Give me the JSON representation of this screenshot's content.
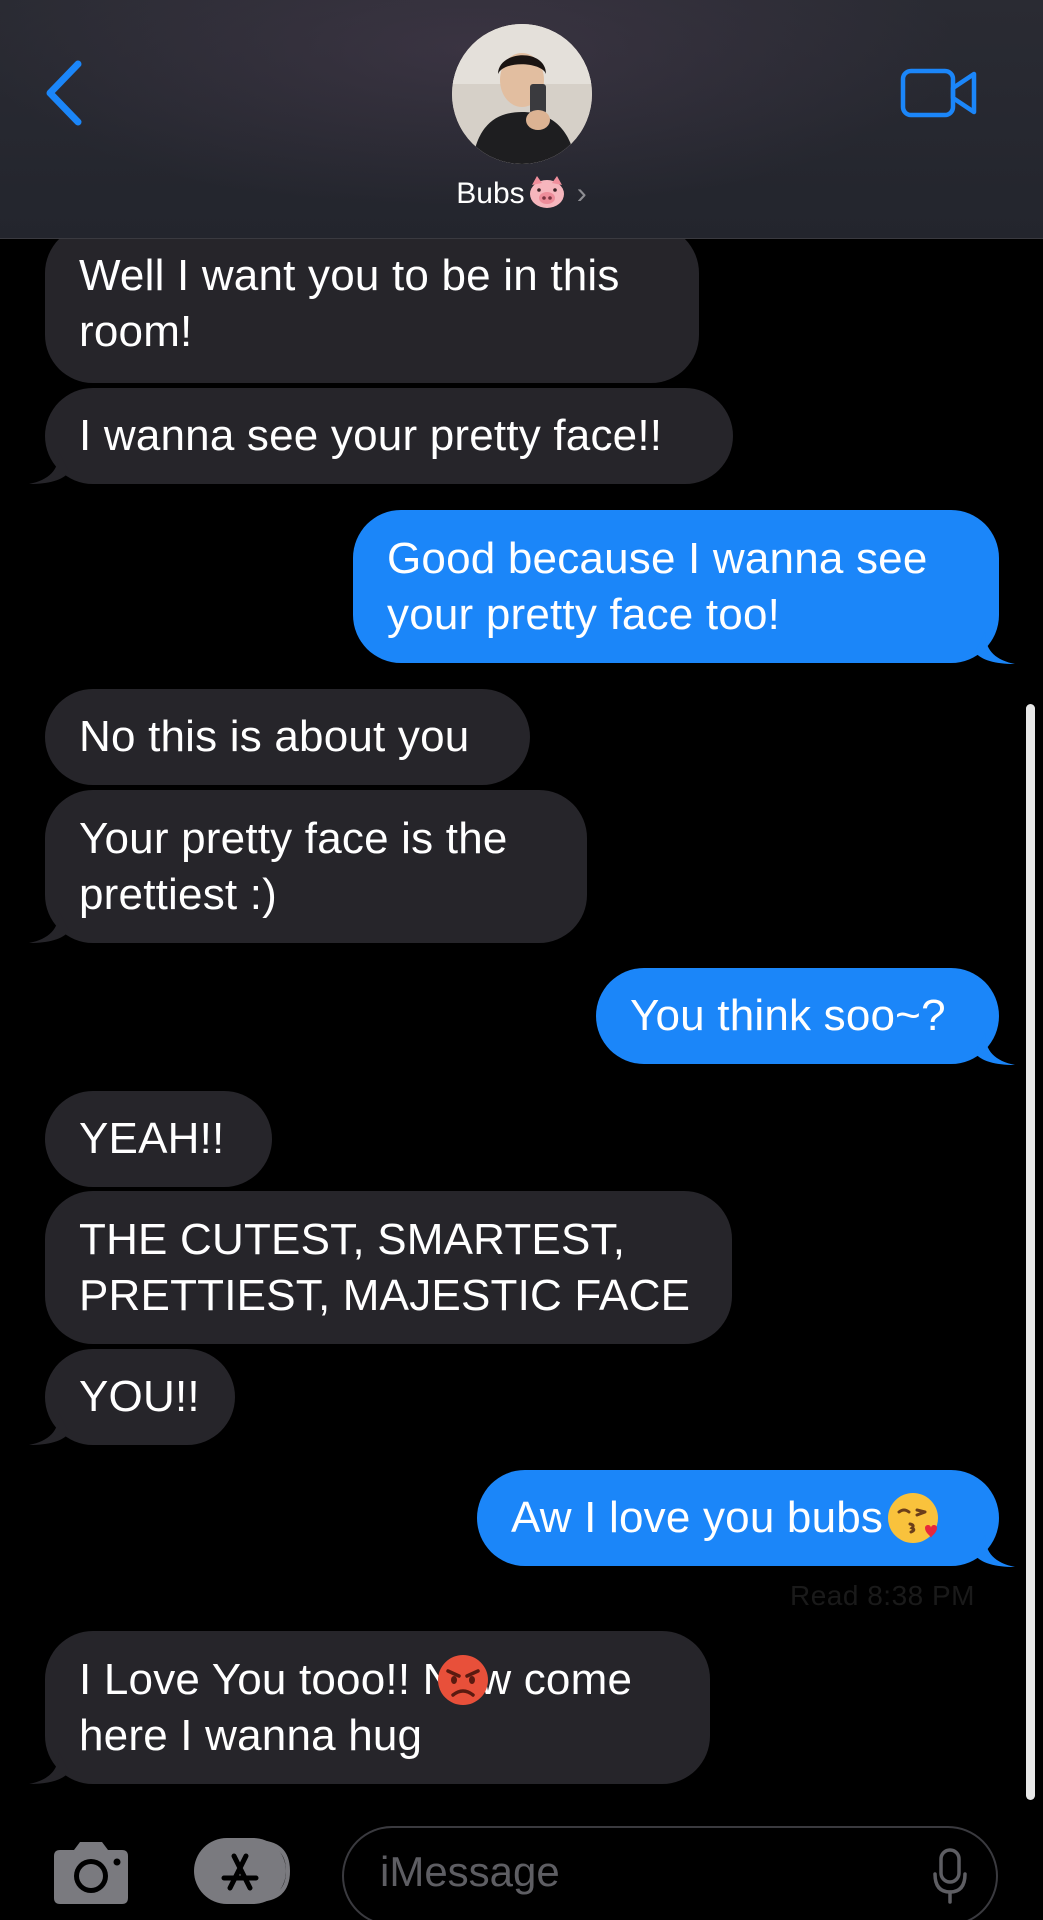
{
  "header": {
    "contact_name": "Bubs",
    "contact_emoji_icon": "pig-face-icon",
    "chevron": "›"
  },
  "messages": [
    {
      "side": "received",
      "text": "Well I want you to be in this\nroom!"
    },
    {
      "side": "received",
      "text": "I wanna see your pretty face!!"
    },
    {
      "side": "sent",
      "text": "Good because I wanna see\nyour pretty face too!"
    },
    {
      "side": "received",
      "text": "No this is about you"
    },
    {
      "side": "received",
      "text": "Your pretty face is the\nprettiest :)"
    },
    {
      "side": "sent",
      "text": "You think soo~?"
    },
    {
      "side": "received",
      "text": "YEAH!!"
    },
    {
      "side": "received",
      "text": "THE CUTEST, SMARTEST,\nPRETTIEST, MAJESTIC FACE"
    },
    {
      "side": "received",
      "text": "YOU!!"
    },
    {
      "side": "sent",
      "text": "Aw I love you bubs",
      "emoji_icon": "face-blowing-kiss-icon"
    },
    {
      "side": "received",
      "text": "I Love You tooo!! Now come\nhere I wanna hug",
      "emoji_icon": "angry-face-icon"
    }
  ],
  "read_receipt": "Read 8:38 PM",
  "composer": {
    "placeholder": "iMessage"
  },
  "colors": {
    "received_bubble": "#26252a",
    "sent_bubble": "#1b86f9",
    "accent": "#1b86f9"
  }
}
